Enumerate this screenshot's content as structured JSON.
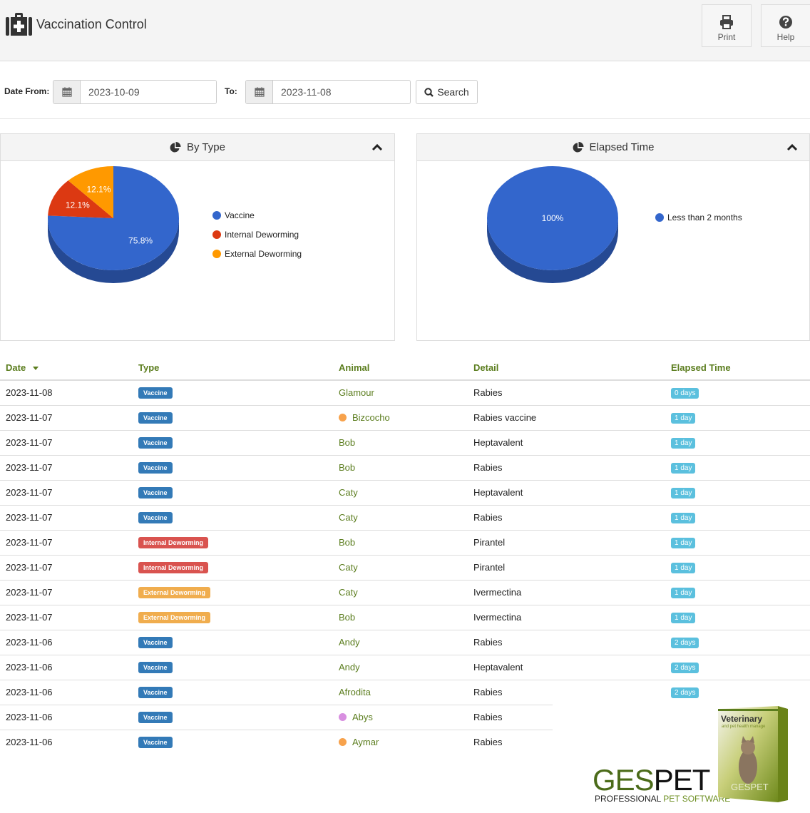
{
  "header": {
    "title": "Vaccination Control",
    "title_icon": "medkit-icon",
    "buttons": [
      {
        "label": "Print",
        "icon": "print-icon"
      },
      {
        "label": "Help",
        "icon": "question-circle-icon"
      }
    ]
  },
  "filter": {
    "date_from_label": "Date From:",
    "date_from_value": "2023-10-09",
    "date_to_label": "To:",
    "date_to_value": "2023-11-08",
    "search_label": "Search"
  },
  "panels": {
    "by_type": {
      "title": "By Type",
      "icon": "pie-chart-icon"
    },
    "elapsed": {
      "title": "Elapsed Time",
      "icon": "pie-chart-icon"
    }
  },
  "chart_data": [
    {
      "type": "pie",
      "title": "By Type",
      "style": "3d",
      "categories": [
        "Vaccine",
        "Internal Deworming",
        "External Deworming"
      ],
      "values": [
        75.8,
        12.1,
        12.1
      ],
      "labels": [
        "75.8%",
        "12.1%",
        "12.1%"
      ],
      "colors": [
        "#3366cc",
        "#dc3912",
        "#ff9900"
      ],
      "legend_position": "right"
    },
    {
      "type": "pie",
      "title": "Elapsed Time",
      "style": "3d",
      "categories": [
        "Less than 2  months"
      ],
      "values": [
        100
      ],
      "labels": [
        "100%"
      ],
      "colors": [
        "#3366cc"
      ],
      "legend_position": "right"
    }
  ],
  "table": {
    "columns": [
      "Date",
      "Type",
      "Animal",
      "Detail",
      "Elapsed Time"
    ],
    "sort_column": "Date",
    "type_colors": {
      "Vaccine": "#337ab7",
      "Internal Deworming": "#d9534f",
      "External Deworming": "#f0ad4e"
    },
    "rows": [
      {
        "date": "2023-11-08",
        "type": "Vaccine",
        "animal": "Glamour",
        "dot": "",
        "detail": "Rabies",
        "elapsed": "0 days"
      },
      {
        "date": "2023-11-07",
        "type": "Vaccine",
        "animal": "Bizcocho",
        "dot": "#f7a24c",
        "detail": "Rabies vaccine",
        "elapsed": "1 day"
      },
      {
        "date": "2023-11-07",
        "type": "Vaccine",
        "animal": "Bob",
        "dot": "",
        "detail": "Heptavalent",
        "elapsed": "1 day"
      },
      {
        "date": "2023-11-07",
        "type": "Vaccine",
        "animal": "Bob",
        "dot": "",
        "detail": "Rabies",
        "elapsed": "1 day"
      },
      {
        "date": "2023-11-07",
        "type": "Vaccine",
        "animal": "Caty",
        "dot": "",
        "detail": "Heptavalent",
        "elapsed": "1 day"
      },
      {
        "date": "2023-11-07",
        "type": "Vaccine",
        "animal": "Caty",
        "dot": "",
        "detail": "Rabies",
        "elapsed": "1 day"
      },
      {
        "date": "2023-11-07",
        "type": "Internal Deworming",
        "animal": "Bob",
        "dot": "",
        "detail": "Pirantel",
        "elapsed": "1 day"
      },
      {
        "date": "2023-11-07",
        "type": "Internal Deworming",
        "animal": "Caty",
        "dot": "",
        "detail": "Pirantel",
        "elapsed": "1 day"
      },
      {
        "date": "2023-11-07",
        "type": "External Deworming",
        "animal": "Caty",
        "dot": "",
        "detail": "Ivermectina",
        "elapsed": "1 day"
      },
      {
        "date": "2023-11-07",
        "type": "External Deworming",
        "animal": "Bob",
        "dot": "",
        "detail": "Ivermectina",
        "elapsed": "1 day"
      },
      {
        "date": "2023-11-06",
        "type": "Vaccine",
        "animal": "Andy",
        "dot": "",
        "detail": "Rabies",
        "elapsed": "2 days"
      },
      {
        "date": "2023-11-06",
        "type": "Vaccine",
        "animal": "Andy",
        "dot": "",
        "detail": "Heptavalent",
        "elapsed": "2 days"
      },
      {
        "date": "2023-11-06",
        "type": "Vaccine",
        "animal": "Afrodita",
        "dot": "",
        "detail": "Rabies",
        "elapsed": "2 days"
      },
      {
        "date": "2023-11-06",
        "type": "Vaccine",
        "animal": "Abys",
        "dot": "#d88fe0",
        "detail": "Rabies",
        "elapsed": ""
      },
      {
        "date": "2023-11-06",
        "type": "Vaccine",
        "animal": "Aymar",
        "dot": "#f7a24c",
        "detail": "Rabies",
        "elapsed": ""
      }
    ]
  },
  "branding": {
    "name_part1": "GES",
    "name_part2": "PET",
    "tagline_part1": "PROFESSIONAL ",
    "tagline_part2": "PET SOFTWARE",
    "box_title": "Veterinary",
    "box_subtitle": "and pet health manage",
    "box_brand": "GESPET"
  }
}
